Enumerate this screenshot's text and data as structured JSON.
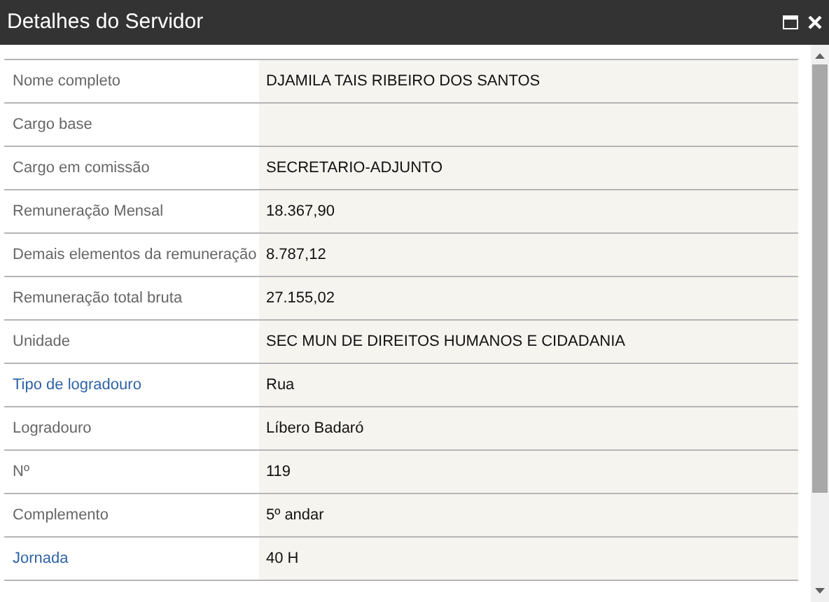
{
  "window": {
    "title": "Detalhes do Servidor"
  },
  "rows": [
    {
      "label": "Nome completo",
      "kind": "text",
      "value": "DJAMILA TAIS RIBEIRO DOS SANTOS"
    },
    {
      "label": "Cargo base",
      "kind": "text"
    },
    {
      "label": "Cargo em comissão",
      "kind": "text",
      "value": "SECRETARIO-ADJUNTO"
    },
    {
      "label": "Remuneração Mensal",
      "kind": "text",
      "value": "18.367,90"
    },
    {
      "label": "Demais elementos da remuneração",
      "kind": "text",
      "value": "8.787,12"
    },
    {
      "label": "Remuneração total bruta",
      "kind": "text",
      "value": "27.155,02"
    },
    {
      "label": "Unidade",
      "kind": "text",
      "value": "SEC MUN DE DIREITOS HUMANOS E CIDADANIA"
    },
    {
      "label": "Tipo de logradouro",
      "kind": "link",
      "value": "Rua"
    },
    {
      "label": "Logradouro",
      "kind": "text",
      "value": "Líbero Badaró"
    },
    {
      "label": "Nº",
      "kind": "text",
      "value": "119"
    },
    {
      "label": "Complemento",
      "kind": "text",
      "value": "5º andar"
    },
    {
      "label": "Jornada",
      "kind": "link",
      "value": "40 H"
    }
  ]
}
